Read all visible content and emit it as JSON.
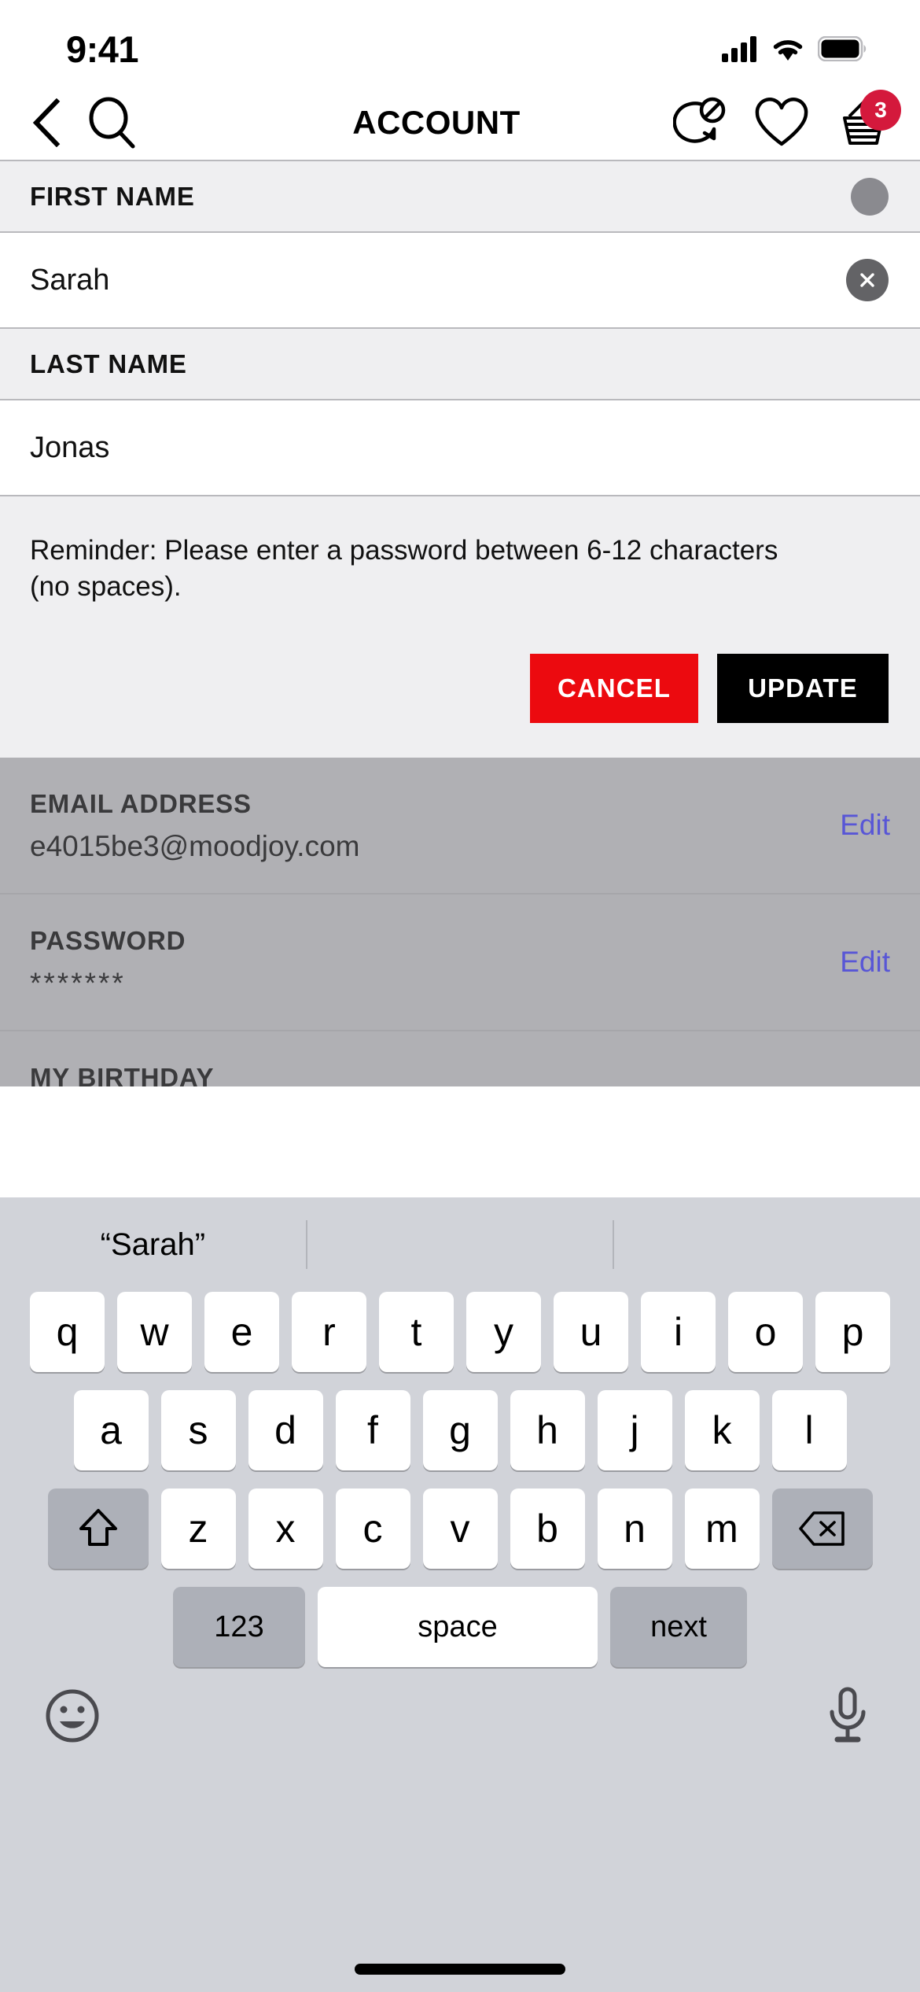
{
  "status_bar": {
    "time": "9:41",
    "cellular_icon": "cellular-signal-icon",
    "wifi_icon": "wifi-icon",
    "battery_icon": "battery-icon"
  },
  "nav": {
    "back_icon": "back-chevron-icon",
    "search_icon": "search-icon",
    "title": "ACCOUNT",
    "chat_icon": "chat-disabled-icon",
    "wishlist_icon": "heart-icon",
    "basket_icon": "basket-icon",
    "basket_count": "3",
    "badge_color": "#D4193C"
  },
  "form": {
    "first_name": {
      "label": "FIRST NAME",
      "value": "Sarah",
      "clear_icon": "clear-circle-icon"
    },
    "last_name": {
      "label": "LAST NAME",
      "value": "Jonas"
    },
    "reminder": "Reminder: Please enter a password between 6-12 characters (no spaces).",
    "cancel_label": "CANCEL",
    "update_label": "UPDATE",
    "cancel_color": "#EC0A0F",
    "update_color": "#000000"
  },
  "locked_section": {
    "email": {
      "label": "EMAIL ADDRESS",
      "value": "e4015be3@moodjoy.com",
      "edit_label": "Edit"
    },
    "password": {
      "label": "PASSWORD",
      "value": "*******",
      "edit_label": "Edit"
    },
    "birthday": {
      "label": "MY BIRTHDAY"
    },
    "edit_link_color": "#5856d6"
  },
  "keyboard": {
    "suggestions": [
      "“Sarah”",
      "",
      ""
    ],
    "row1": [
      "q",
      "w",
      "e",
      "r",
      "t",
      "y",
      "u",
      "i",
      "o",
      "p"
    ],
    "row2": [
      "a",
      "s",
      "d",
      "f",
      "g",
      "h",
      "j",
      "k",
      "l"
    ],
    "row3": [
      "z",
      "x",
      "c",
      "v",
      "b",
      "n",
      "m"
    ],
    "shift_icon": "shift-arrow-icon",
    "backspace_icon": "backspace-icon",
    "numbers_label": "123",
    "space_label": "space",
    "next_label": "next",
    "emoji_icon": "emoji-smiley-icon",
    "mic_icon": "microphone-icon"
  }
}
